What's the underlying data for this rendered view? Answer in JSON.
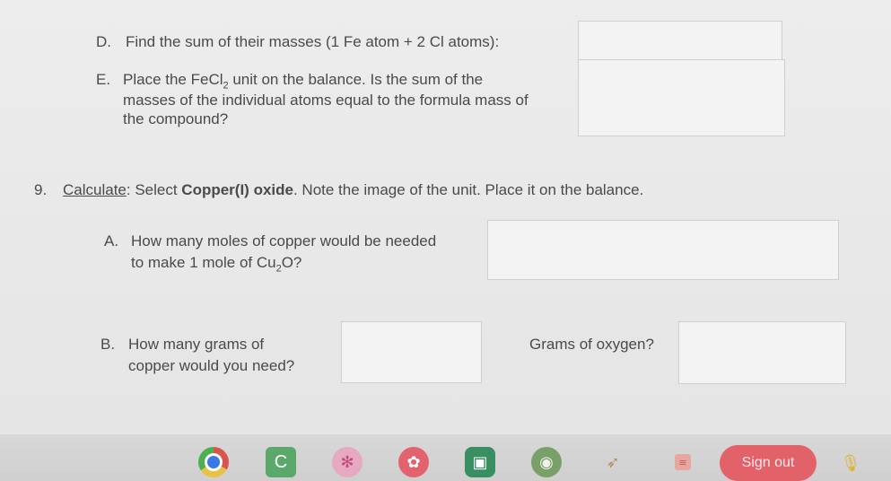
{
  "worksheet": {
    "d": {
      "letter": "D.",
      "text": "Find the sum of their masses (1 Fe atom + 2 Cl atoms):"
    },
    "e": {
      "letter": "E.",
      "line1_pre": "Place the FeCl",
      "line1_sub": "2",
      "line1_post": " unit on the balance. Is the sum of the",
      "line2": "masses of the individual atoms equal to the formula mass of",
      "line3": "the compound?"
    },
    "q9": {
      "number": "9.",
      "label": "Calculate",
      "colon": ": Select ",
      "bold": "Copper(I) oxide",
      "rest": ". Note the image of the unit. Place it on the balance."
    },
    "a": {
      "letter": "A.",
      "line1": "How many moles of copper would be needed",
      "line2_pre": "to make 1 mole of Cu",
      "line2_sub": "2",
      "line2_post": "O?"
    },
    "b": {
      "letter": "B.",
      "line1": "How many grams of",
      "line2": "copper would you need?",
      "oxygen": "Grams of oxygen?"
    }
  },
  "taskbar": {
    "apps": [
      "chrome-icon",
      "classroom-icon",
      "settings-icon",
      "paint-icon",
      "meet-icon",
      "camera-icon",
      "rocket-icon",
      "notes-icon"
    ],
    "signout_label": "Sign out",
    "accent": "#e3626a"
  }
}
